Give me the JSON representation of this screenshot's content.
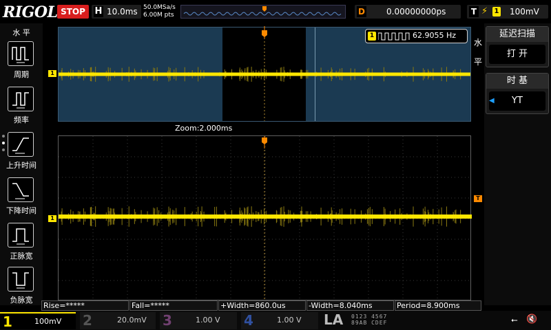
{
  "header": {
    "brand": "RIGOL",
    "run_state": "STOP",
    "horizontal_label": "H",
    "horizontal_scale": "10.0ms",
    "sample_rate": "50.0MSa/s",
    "memory_depth": "6.00M pts",
    "delay_label": "D",
    "delay_value": "0.00000000ps",
    "trigger_label": "T",
    "trigger_channel": "1",
    "trigger_level": "100mV"
  },
  "left_menu": {
    "title": "水 平",
    "items": [
      {
        "label": "周期",
        "icon": "period-icon"
      },
      {
        "label": "频率",
        "icon": "frequency-icon"
      },
      {
        "label": "上升时间",
        "icon": "rise-time-icon"
      },
      {
        "label": "下降时间",
        "icon": "fall-time-icon"
      },
      {
        "label": "正脉宽",
        "icon": "positive-width-icon"
      },
      {
        "label": "负脉宽",
        "icon": "negative-width-icon"
      }
    ]
  },
  "screen": {
    "zoom_label": "Zoom:2.000ms",
    "channel_marker": "1",
    "trigger_marker": "T",
    "frequency_channel": "1",
    "frequency_value": "62.9055 Hz",
    "trace_color": "#ffe600"
  },
  "right_menu": {
    "side_title_line1": "水",
    "side_title_line2": "平",
    "delayed_sweep_header": "延迟扫描",
    "delayed_sweep_value": "打 开",
    "timebase_header": "时 基",
    "timebase_value": "YT"
  },
  "measurements": {
    "rise": "Rise=*****",
    "fall": "Fall=*****",
    "pos_width": "+Width=860.0us",
    "neg_width": "-Width=8.040ms",
    "period": "Period=8.900ms"
  },
  "channels": [
    {
      "num": "1",
      "scale": "100mV",
      "color": "#ffe600"
    },
    {
      "num": "2",
      "scale": "20.0mV",
      "color": "#00e5ff"
    },
    {
      "num": "3",
      "scale": "1.00 V",
      "color": "#ff40c0"
    },
    {
      "num": "4",
      "scale": "1.00 V",
      "color": "#2a7fff"
    }
  ],
  "logic": {
    "label": "LA",
    "row1": "0123 4567",
    "row2": "89AB CDEF"
  }
}
